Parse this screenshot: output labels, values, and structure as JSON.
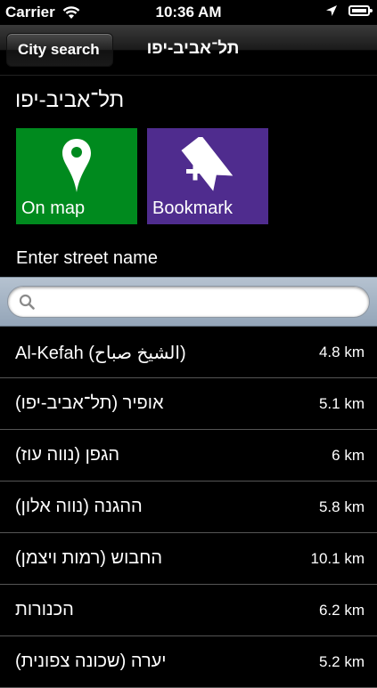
{
  "status_bar": {
    "carrier": "Carrier",
    "time": "10:36 AM",
    "icons": [
      "wifi-icon",
      "location-arrow-icon",
      "battery-icon"
    ]
  },
  "nav": {
    "back_label": "City search",
    "title": "תל־אביב-יפו"
  },
  "city": {
    "title": "תל־אביב-יפו"
  },
  "tiles": {
    "map": {
      "label": "On map",
      "icon": "map-pin-icon",
      "color": "#008a1e"
    },
    "bookmark": {
      "label": "Bookmark",
      "icon": "bookmark-add-icon",
      "color": "#4f2c8e"
    }
  },
  "street_search": {
    "label": "Enter street name",
    "value": "",
    "placeholder": ""
  },
  "streets": [
    {
      "name": "Al-Kefah (الشيخ صباح)",
      "distance": "4.8 km"
    },
    {
      "name": "אופיר (תל־אביב-יפו)",
      "distance": "5.1 km"
    },
    {
      "name": "הגפן (נווה עוז)",
      "distance": "6 km"
    },
    {
      "name": "ההגנה (נווה אלון)",
      "distance": "5.8 km"
    },
    {
      "name": "החבוש (רמות ויצמן)",
      "distance": "10.1 km"
    },
    {
      "name": "הכנורות",
      "distance": "6.2 km"
    },
    {
      "name": "יערה (שכונה צפונית)",
      "distance": "5.2 km"
    }
  ]
}
